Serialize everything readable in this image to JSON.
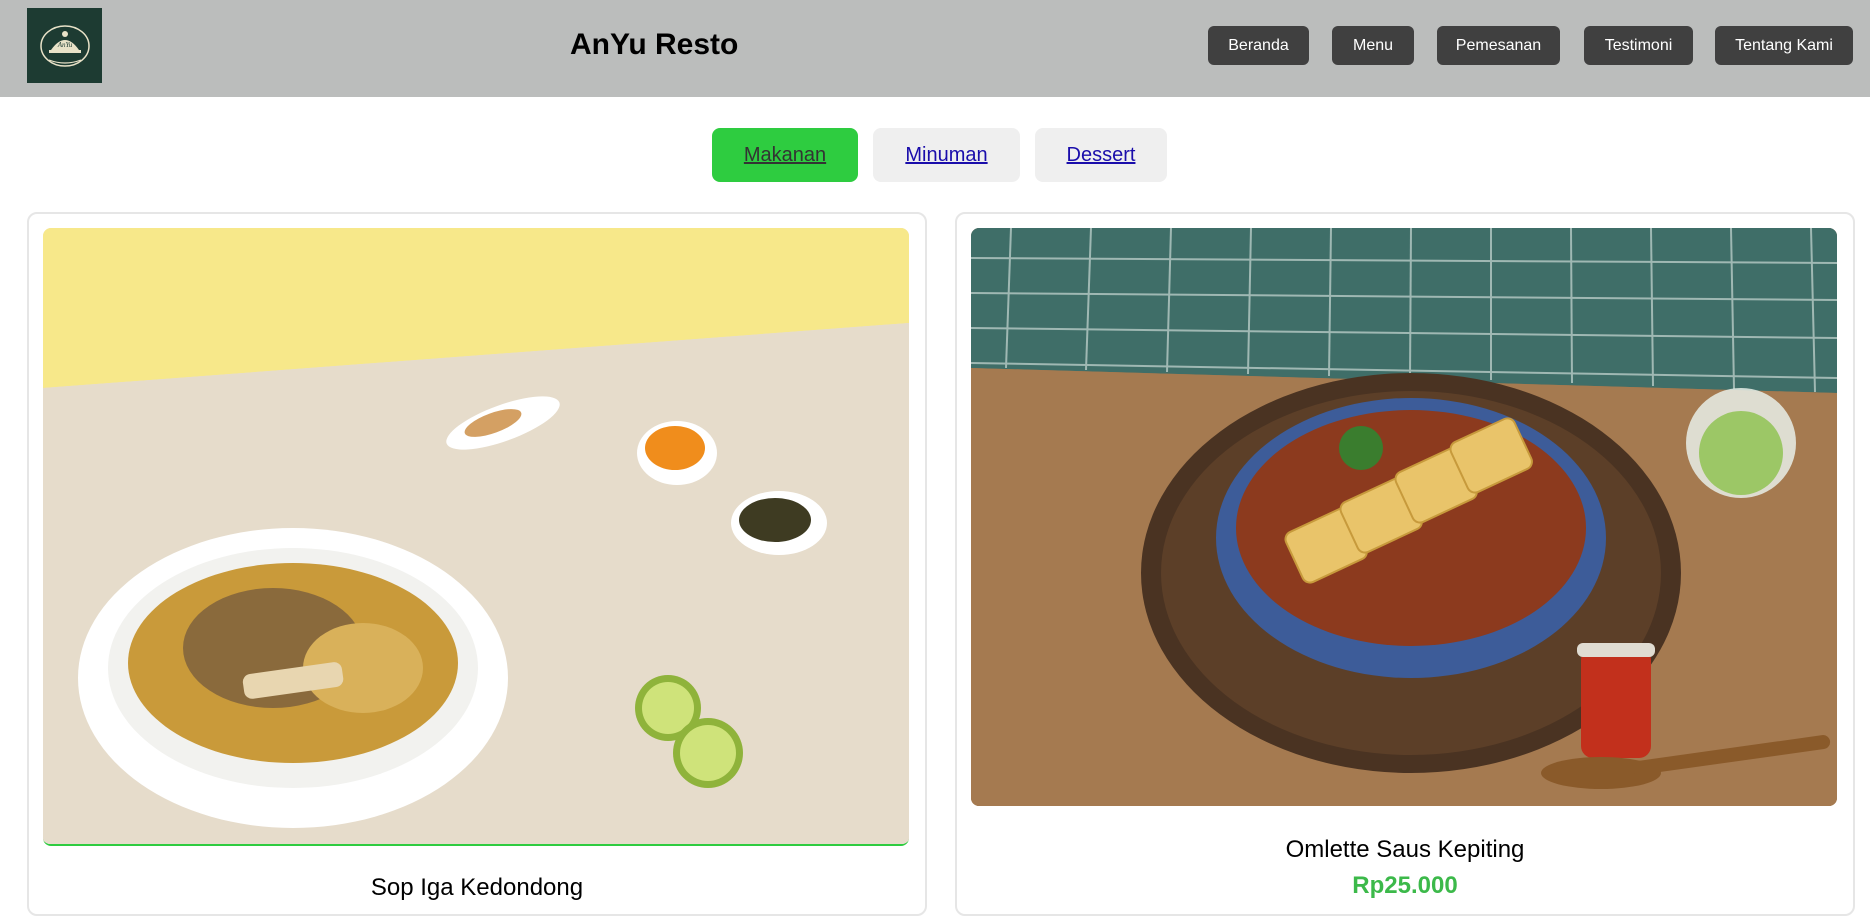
{
  "header": {
    "title": "AnYu Resto",
    "logo_icon": "chef-hat-logo-icon",
    "nav": [
      {
        "label": "Beranda"
      },
      {
        "label": "Menu"
      },
      {
        "label": "Pemesanan"
      },
      {
        "label": "Testimoni"
      },
      {
        "label": "Tentang Kami"
      }
    ]
  },
  "tabs": [
    {
      "label": "Makanan",
      "active": true
    },
    {
      "label": "Minuman",
      "active": false
    },
    {
      "label": "Dessert",
      "active": false
    }
  ],
  "menu_items": [
    {
      "name": "Sop Iga Kedondong",
      "image": "soup-bowl-photo"
    },
    {
      "name": "Omlette Saus Kepiting",
      "price": "Rp25.000",
      "image": "omelette-bowl-photo"
    }
  ],
  "colors": {
    "header_bg": "#bbbdbc",
    "nav_button_bg": "#404040",
    "active_tab": "#2ecc40",
    "price": "#3cb94a"
  }
}
